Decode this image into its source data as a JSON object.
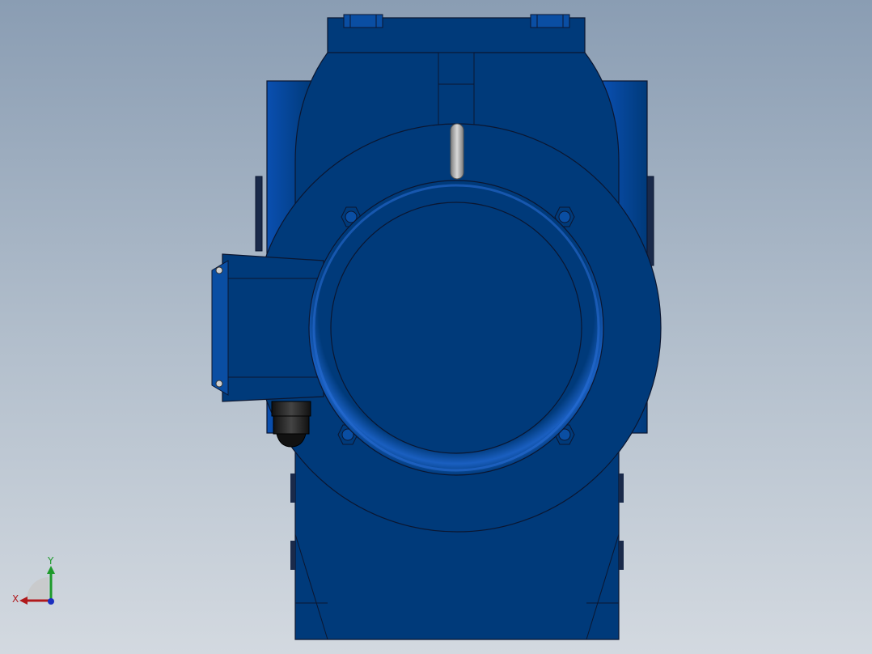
{
  "viewport": {
    "background_top": "#8a9db3",
    "background_bottom": "#d3d9e0"
  },
  "model": {
    "body_color": "#003a7a",
    "body_light": "#0a4ea3",
    "edge_color": "#0b1630",
    "accent_grey": "#9a9a9a",
    "gland_color": "#1a1a1a"
  },
  "triad": {
    "x_label": "X",
    "y_label": "Y",
    "x_color": "#b0191c",
    "y_color": "#1d9a2b",
    "z_color": "#1b2fbf"
  }
}
